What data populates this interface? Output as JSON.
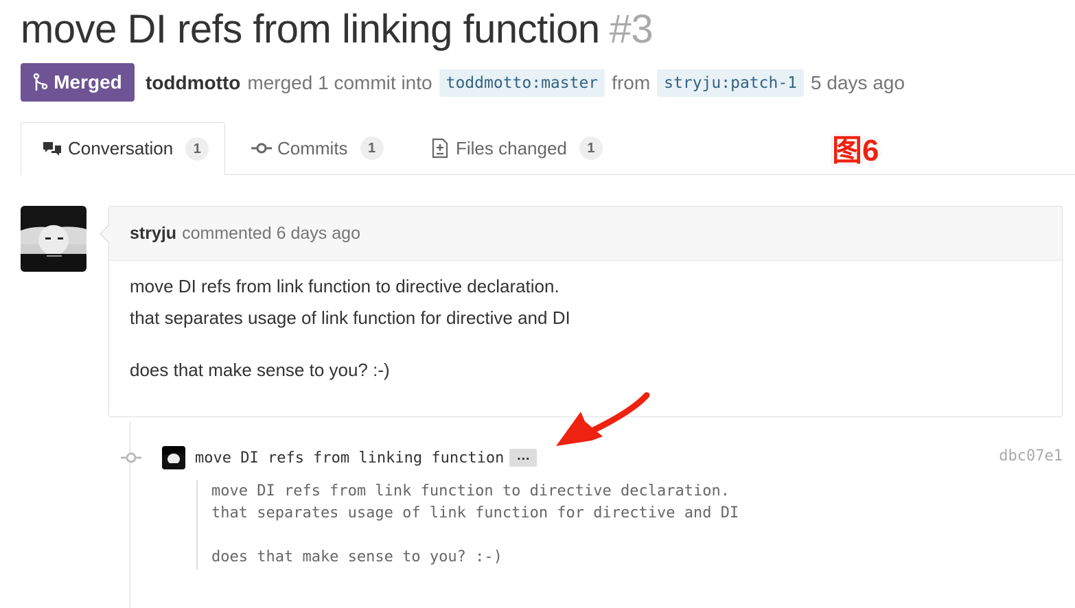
{
  "pr": {
    "title": "move DI refs from linking function",
    "number": "#3",
    "state_label": "Merged",
    "author": "toddmotto",
    "action": "merged 1 commit into",
    "base_ref": "toddmotto:master",
    "from_word": "from",
    "head_ref": "stryju:patch-1",
    "time": "5 days ago"
  },
  "tabs": [
    {
      "label": "Conversation",
      "count": "1",
      "icon": "comment-discussion-icon"
    },
    {
      "label": "Commits",
      "count": "1",
      "icon": "git-commit-icon"
    },
    {
      "label": "Files changed",
      "count": "1",
      "icon": "file-diff-icon"
    }
  ],
  "annotation": "图6",
  "comment": {
    "author": "stryju",
    "meta": "commented 6 days ago",
    "lines": [
      "move DI refs from link function to directive declaration.",
      "that separates usage of link function for directive and DI",
      "does that make sense to you? :-)"
    ]
  },
  "commit": {
    "message": "move DI refs from linking function",
    "ellipsis": "…",
    "sha": "dbc07e1",
    "description": "move DI refs from link function to directive declaration.\nthat separates usage of link function for directive and DI\n\ndoes that make sense to you? :-)"
  },
  "colors": {
    "merged": "#6e5494",
    "ref_bg": "#e8f1f6",
    "ref_text": "#336382",
    "annotation": "#ee2211"
  }
}
